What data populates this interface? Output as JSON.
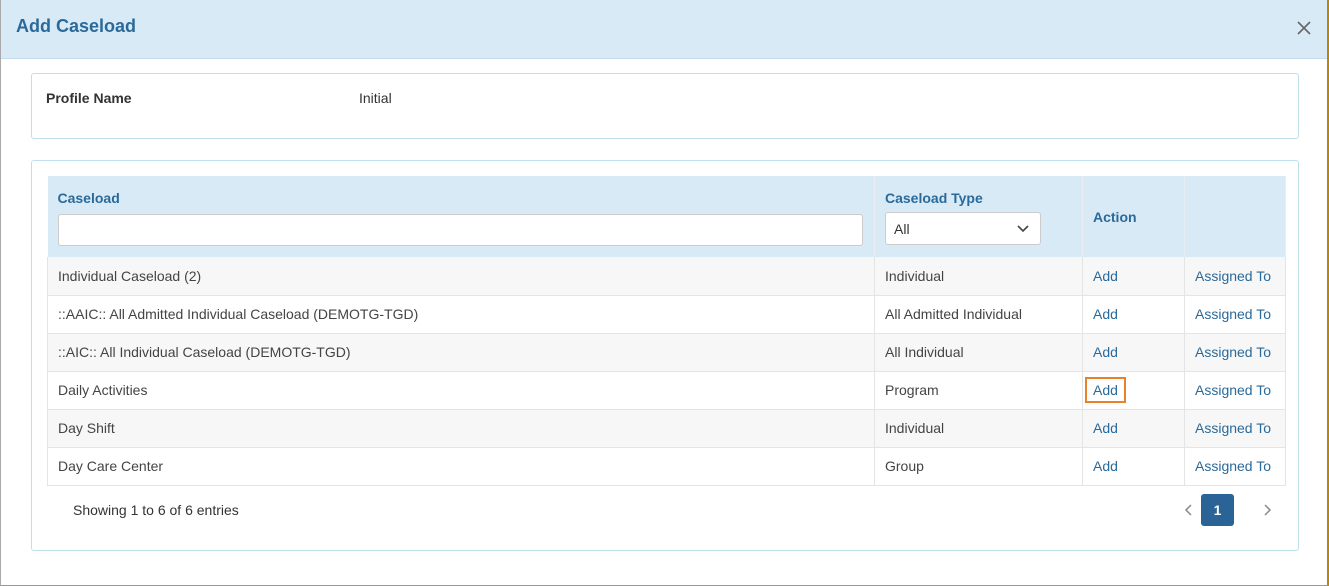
{
  "modal": {
    "title": "Add Caseload",
    "close_icon": "close-icon"
  },
  "profile": {
    "label": "Profile Name",
    "value": "Initial"
  },
  "table": {
    "headers": {
      "caseload": "Caseload",
      "caseload_type": "Caseload Type",
      "action": "Action",
      "assigned": ""
    },
    "filters": {
      "caseload_value": "",
      "caseload_type_selected": "All"
    },
    "rows": [
      {
        "caseload": "Individual Caseload (2)",
        "type": "Individual",
        "action": "Add",
        "assigned": "Assigned To"
      },
      {
        "caseload": "::AAIC:: All Admitted Individual Caseload (DEMOTG-TGD)",
        "type": "All Admitted Individual",
        "action": "Add",
        "assigned": "Assigned To"
      },
      {
        "caseload": "::AIC:: All Individual Caseload (DEMOTG-TGD)",
        "type": "All Individual",
        "action": "Add",
        "assigned": "Assigned To"
      },
      {
        "caseload": "Daily Activities",
        "type": "Program",
        "action": "Add",
        "assigned": "Assigned To"
      },
      {
        "caseload": "Day Shift",
        "type": "Individual",
        "action": "Add",
        "assigned": "Assigned To"
      },
      {
        "caseload": "Day Care Center",
        "type": "Group",
        "action": "Add",
        "assigned": "Assigned To"
      }
    ]
  },
  "footer": {
    "info": "Showing 1 to 6 of 6 entries",
    "current_page": "1",
    "prev_icon": "chevron-left-icon",
    "next_icon": "chevron-right-icon"
  },
  "colors": {
    "header_bg": "#d9eaf7",
    "accent": "#2a6a9a",
    "focus_outline": "#e8822a",
    "page_active": "#2a6496"
  }
}
